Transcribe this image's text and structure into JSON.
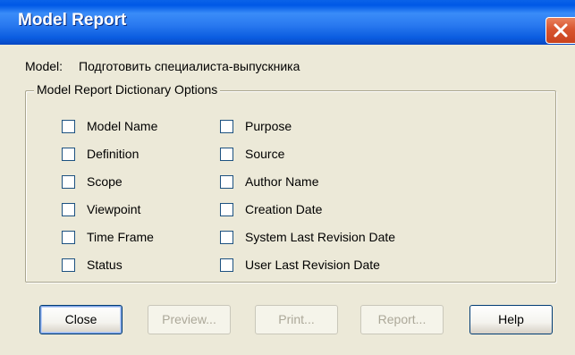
{
  "window": {
    "title": "Model Report"
  },
  "model": {
    "label": "Model:",
    "value": "Подготовить специалиста-выпускника"
  },
  "options_group": {
    "legend": "Model Report Dictionary Options",
    "left_column": [
      {
        "label": "Model Name",
        "checked": false
      },
      {
        "label": "Definition",
        "checked": false
      },
      {
        "label": "Scope",
        "checked": false
      },
      {
        "label": "Viewpoint",
        "checked": false
      },
      {
        "label": "Time Frame",
        "checked": false
      },
      {
        "label": "Status",
        "checked": false
      }
    ],
    "right_column": [
      {
        "label": "Purpose",
        "checked": false
      },
      {
        "label": "Source",
        "checked": false
      },
      {
        "label": "Author Name",
        "checked": false
      },
      {
        "label": "Creation Date",
        "checked": false
      },
      {
        "label": "System Last Revision Date",
        "checked": false
      },
      {
        "label": "User Last Revision Date",
        "checked": false
      }
    ]
  },
  "buttons": {
    "close": "Close",
    "preview": "Preview...",
    "print": "Print...",
    "report": "Report...",
    "help": "Help"
  },
  "colors": {
    "titlebar": "#0A5CE0",
    "dialog_bg": "#ECE9D8",
    "close_button": "#D8552F"
  },
  "icons": {
    "close": "close-icon"
  }
}
